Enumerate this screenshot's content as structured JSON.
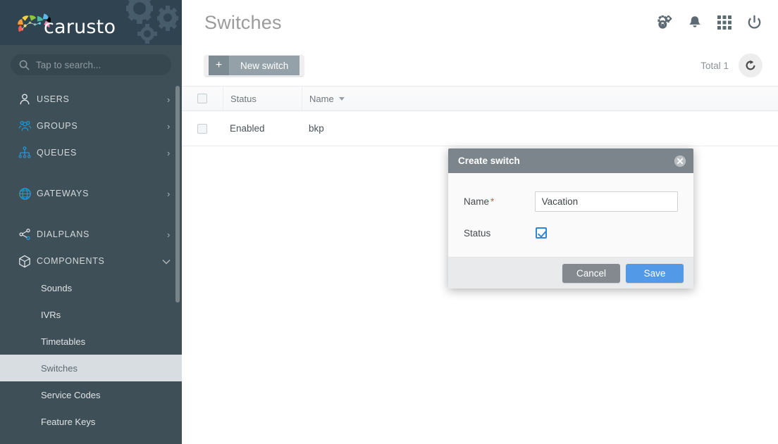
{
  "brand": {
    "name": "carusto",
    "logo_icon": "carusto-fan-logo",
    "gear_decoration_icon": "gears-decoration-icon"
  },
  "sidebar": {
    "search": {
      "placeholder": "Tap to search...",
      "value": "",
      "icon": "search-icon"
    },
    "items": [
      {
        "label": "USERS",
        "icon": "user-icon",
        "chevron": "›",
        "expanded": false
      },
      {
        "label": "GROUPS",
        "icon": "users-group-icon",
        "chevron": "›",
        "expanded": false
      },
      {
        "label": "QUEUES",
        "icon": "hierarchy-icon",
        "chevron": "›",
        "expanded": false
      },
      {
        "label": "GATEWAYS",
        "icon": "globe-icon",
        "chevron": "›",
        "expanded": false
      },
      {
        "label": "DIALPLANS",
        "icon": "share-nodes-icon",
        "chevron": "›",
        "expanded": false
      },
      {
        "label": "COMPONENTS",
        "icon": "cube-icon",
        "chevron": "∨",
        "expanded": true
      }
    ],
    "sub_items": [
      {
        "label": "Sounds",
        "active": false
      },
      {
        "label": "IVRs",
        "active": false
      },
      {
        "label": "Timetables",
        "active": false
      },
      {
        "label": "Switches",
        "active": true
      },
      {
        "label": "Service Codes",
        "active": false
      },
      {
        "label": "Feature Keys",
        "active": false
      }
    ]
  },
  "header": {
    "title": "Switches",
    "icons": [
      {
        "name": "settings-gears-icon"
      },
      {
        "name": "bell-icon"
      },
      {
        "name": "apps-grid-icon"
      },
      {
        "name": "power-icon"
      }
    ]
  },
  "toolbar": {
    "new_button_label": "New switch",
    "new_button_plus": "+",
    "total_label": "Total 1",
    "refresh_icon": "refresh-icon"
  },
  "table": {
    "columns": [
      {
        "key": "select",
        "label": ""
      },
      {
        "key": "status",
        "label": "Status"
      },
      {
        "key": "name",
        "label": "Name",
        "sorted": true,
        "sort_dir": "desc"
      }
    ],
    "rows": [
      {
        "selected": false,
        "status": "Enabled",
        "name": "bkp"
      }
    ]
  },
  "modal": {
    "title": "Create switch",
    "close_icon": "close-circle-icon",
    "fields": {
      "name": {
        "label": "Name",
        "required_marker": "*",
        "value": "Vacation",
        "placeholder": ""
      },
      "status": {
        "label": "Status",
        "checked": true
      }
    },
    "cancel_label": "Cancel",
    "save_label": "Save"
  },
  "colors": {
    "sidebar_bg": "#3e4f57",
    "logo_bar_bg": "#2f4450",
    "accent_blue": "#529ae8",
    "active_item_bg": "#d7dde1",
    "required_red": "#d9534f",
    "button_gray": "#94a1a8"
  }
}
